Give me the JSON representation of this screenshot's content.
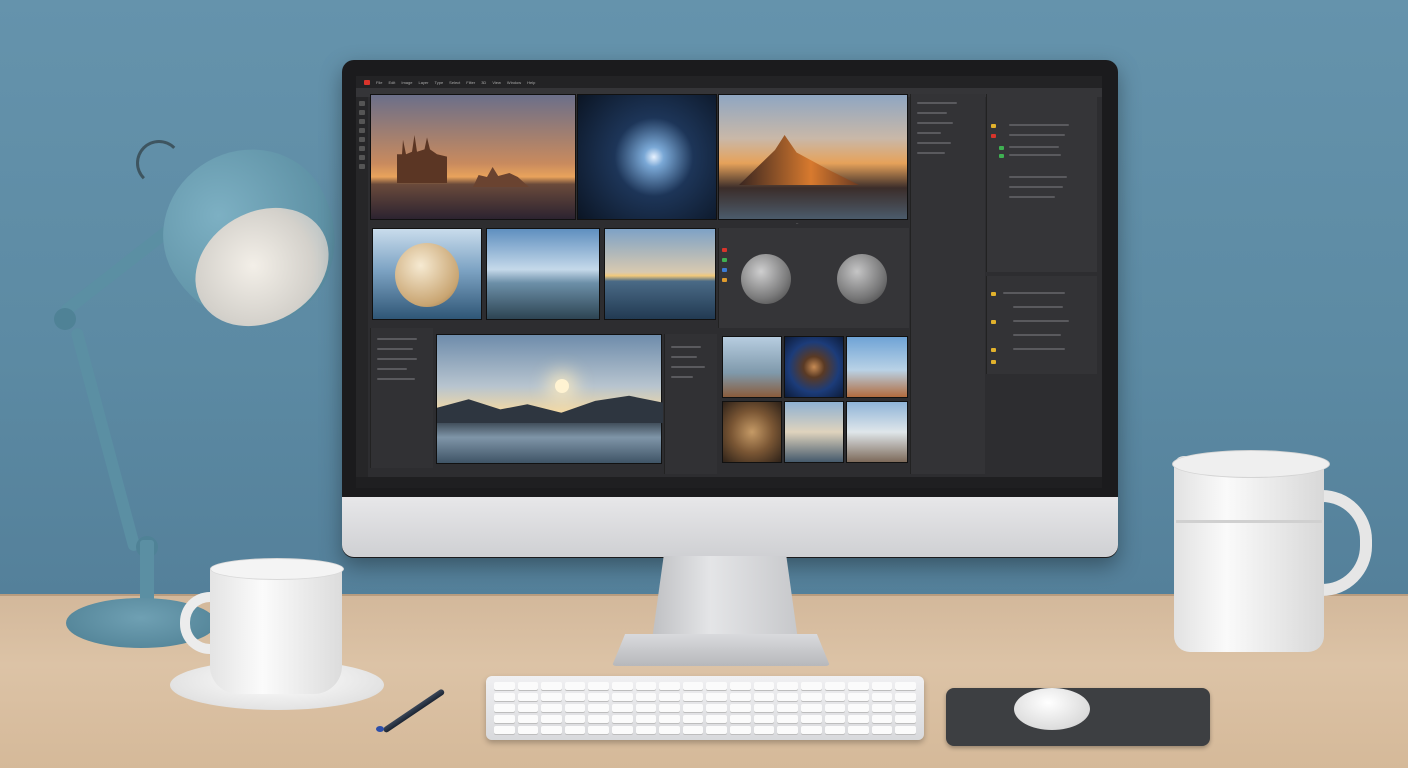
{
  "scene": {
    "description_items": [
      "desk-lamp",
      "coffee-cup",
      "saucer",
      "monitor",
      "keyboard",
      "mouse",
      "mousepad",
      "mug",
      "pen"
    ]
  },
  "screen": {
    "menubar": [
      "File",
      "Edit",
      "Image",
      "Layer",
      "Type",
      "Select",
      "Filter",
      "3D",
      "View",
      "Window",
      "Help"
    ],
    "photos": [
      {
        "id": "castle-sunset",
        "label": ""
      },
      {
        "id": "starburst",
        "label": ""
      },
      {
        "id": "mountain-sunset",
        "label": ""
      },
      {
        "id": "sphere-coin",
        "label": ""
      },
      {
        "id": "sky-water-1",
        "label": ""
      },
      {
        "id": "sun-horizon",
        "label": ""
      },
      {
        "id": "main-seascape",
        "label": ""
      },
      {
        "id": "grid-1",
        "label": ""
      },
      {
        "id": "grid-2",
        "label": ""
      },
      {
        "id": "grid-3",
        "label": ""
      },
      {
        "id": "grid-4",
        "label": ""
      },
      {
        "id": "grid-5",
        "label": ""
      },
      {
        "id": "grid-6",
        "label": ""
      }
    ]
  },
  "colors": {
    "wall": "#5d8ba4",
    "desk": "#d7bc9f",
    "lamp": "#5b8fa3",
    "ui_bg": "#2d2d30"
  }
}
